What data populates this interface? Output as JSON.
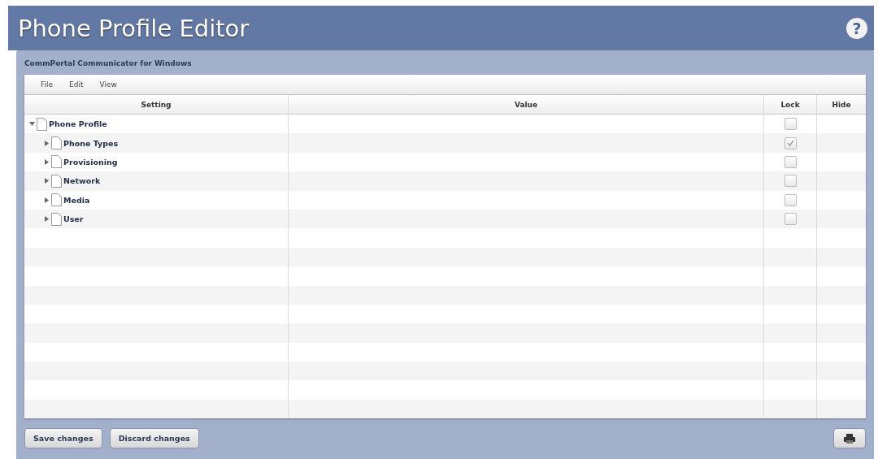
{
  "header": {
    "title": "Phone Profile Editor",
    "help": "?"
  },
  "panel": {
    "title": "CommPortal Communicator for Windows"
  },
  "menu": [
    "File",
    "Edit",
    "View"
  ],
  "table": {
    "columns": [
      "Setting",
      "Value",
      "Lock",
      "Hide"
    ],
    "tree": [
      {
        "label": "Phone Profile",
        "expanded": true,
        "locked": false,
        "children": [
          {
            "label": "Phone Types",
            "expanded": false,
            "locked": true
          },
          {
            "label": "Provisioning",
            "expanded": false,
            "locked": false
          },
          {
            "label": "Network",
            "expanded": false,
            "locked": false
          },
          {
            "label": "Media",
            "expanded": false,
            "locked": false
          },
          {
            "label": "User",
            "expanded": false,
            "locked": false
          }
        ]
      }
    ]
  },
  "buttons": [
    "Save changes",
    "Discard changes"
  ]
}
